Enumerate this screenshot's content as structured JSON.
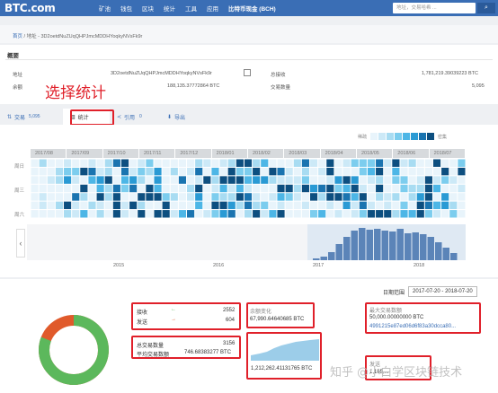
{
  "header": {
    "logo": "BTC.com",
    "nav": [
      "矿池",
      "钱包",
      "区块",
      "统计",
      "工具",
      "应用",
      "比特币现金 (BCH)"
    ],
    "search_placeholder": "地址，交易哈希 ...",
    "search_icon": "search-icon"
  },
  "breadcrumb": {
    "home": "首页",
    "sep": "/",
    "current": "地址 - 3D2oetdNuZUqQHPJmcMDDHYoqkyNVsFk9r"
  },
  "overview": {
    "title": "概要",
    "address_label": "地址",
    "address_value": "3D2oetdNuZUqQHPJmcMDDHYoqkyNVsFk9r",
    "balance_label": "余额",
    "balance_value": "188,135.37772864 BTC",
    "received_label": "总接收",
    "received_value": "1,781,219.39039223 BTC",
    "tx_count_label": "交易数量",
    "tx_count_value": "5,095"
  },
  "annotation_text": "选择统计",
  "tabs": [
    {
      "label": "交易",
      "count": "5,095",
      "icon": "list-icon"
    },
    {
      "label": "统计",
      "count": "",
      "icon": "bar-chart-icon"
    },
    {
      "label": "引用",
      "count": "0",
      "icon": "share-icon"
    },
    {
      "label": "导出",
      "count": "",
      "icon": "download-icon"
    }
  ],
  "heatmap": {
    "legend_low": "稀疏",
    "legend_high": "密集",
    "months": [
      "2017/08",
      "2017/09",
      "2017/10",
      "2017/11",
      "2017/12",
      "2018/01",
      "2018/02",
      "2018/03",
      "2018/04",
      "2018/05",
      "2018/06",
      "2018/07"
    ],
    "row_labels": [
      "周日",
      "周三",
      "周六"
    ],
    "colors": [
      "#e8f4fb",
      "#cce9f7",
      "#a8dcf2",
      "#7ccdee",
      "#4db6e6",
      "#2a9ad4",
      "#1a74b0",
      "#0d4f80"
    ],
    "timeline_years": [
      "2015",
      "2016",
      "2017",
      "2018"
    ]
  },
  "date_range": {
    "label": "日期范围",
    "from": "2017-07-20",
    "to": "2018-07-20"
  },
  "stats": {
    "receive_label": "接收",
    "receive_value": "2552",
    "send_label": "发送",
    "send_value": "604",
    "total_tx_label": "总交易数量",
    "total_tx_value": "3156",
    "avg_amount_label": "平均交易数额",
    "avg_amount_value": "746.68383277 BTC",
    "balance_change_label": "余额变化",
    "balance_change_value": "67,990.64640685 BTC",
    "recv_label": "接收",
    "recv_value": "1,212,262.41131765 BTC",
    "max_tx_label": "最大交易数额",
    "max_tx_value": "50,000.00000000 BTC",
    "max_tx_hash": "4991215e87ed06d6f83a30dcca80...",
    "send2_label": "发送",
    "send2_value": "1,165,...",
    "pie_colors": [
      "#5cb85c",
      "#e05a2b"
    ],
    "pie_fraction_receive": 0.8086
  },
  "watermark": "知乎 @小白学区块链技术"
}
